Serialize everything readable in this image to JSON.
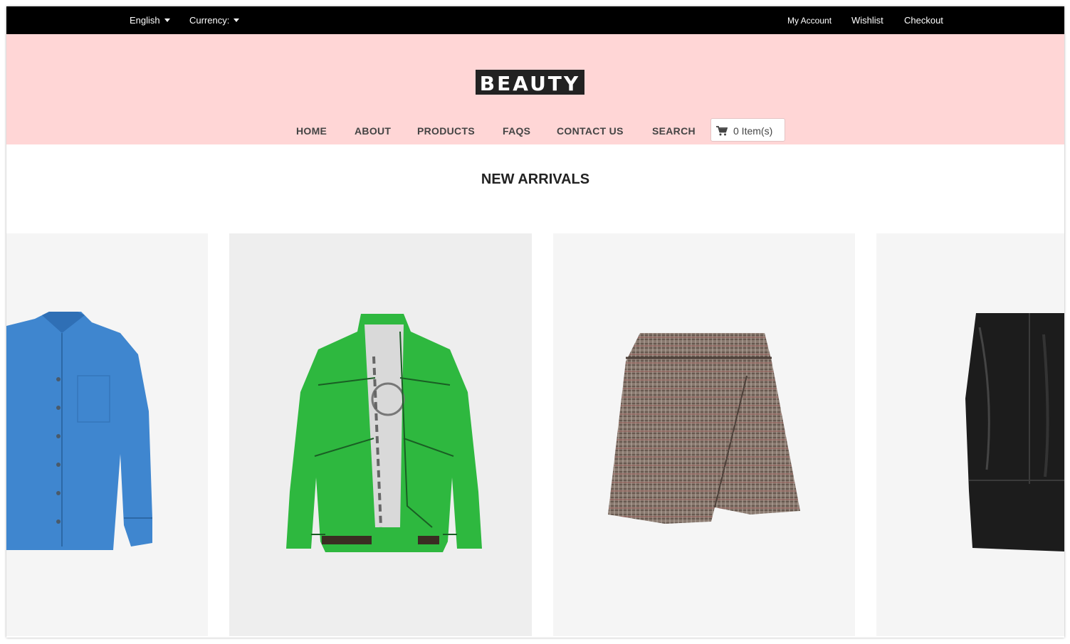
{
  "topbar": {
    "language": "English",
    "currency": "Currency:",
    "my_account": "My Account",
    "wishlist": "Wishlist",
    "checkout": "Checkout"
  },
  "header": {
    "logo_text": "BEAUTY",
    "background_color": "#ffd6d6",
    "nav": [
      "HOME",
      "ABOUT",
      "PRODUCTS",
      "FAQS",
      "CONTACT US",
      "SEARCH"
    ],
    "cart_label": "0 Item(s)"
  },
  "section": {
    "title": "NEW ARRIVALS"
  },
  "products": [
    {
      "image": "blue-dress-shirt",
      "color": "#3f86cf"
    },
    {
      "image": "green-zip-jacket",
      "color": "#2eb83f"
    },
    {
      "image": "plaid-mini-skirt",
      "color": "#7a6a60"
    },
    {
      "image": "black-leather-skirt",
      "color": "#1c1c1c"
    }
  ]
}
